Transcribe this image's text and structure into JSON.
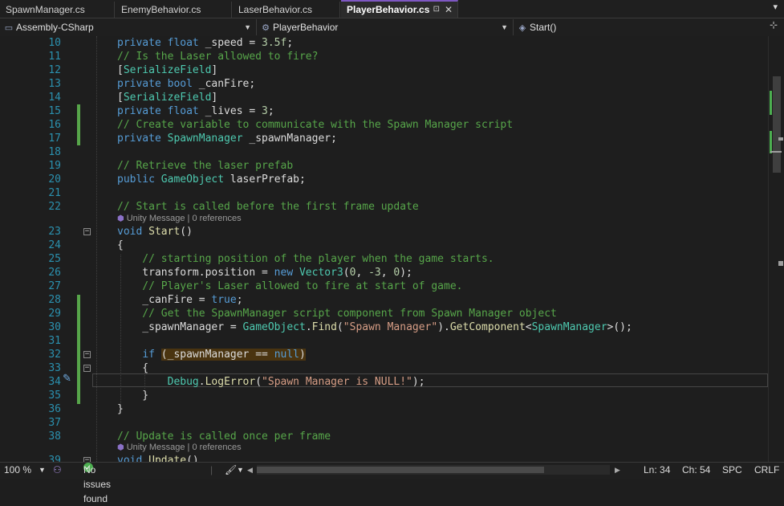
{
  "tabs": [
    {
      "label": "SpawnManager.cs",
      "active": false
    },
    {
      "label": "EnemyBehavior.cs",
      "active": false
    },
    {
      "label": "LaserBehavior.cs",
      "active": false
    },
    {
      "label": "PlayerBehavior.cs",
      "active": true
    }
  ],
  "nav": {
    "project": "Assembly-CSharp",
    "class": "PlayerBehavior",
    "member": "Start()"
  },
  "codelens": {
    "start": "Unity Message | 0 references",
    "update": "Unity Message | 0 references"
  },
  "lines": [
    {
      "n": "10",
      "text": "private float _speed = 3.5f;"
    },
    {
      "n": "11",
      "text": "// Is the Laser allowed to fire?"
    },
    {
      "n": "12",
      "text": "[SerializeField]"
    },
    {
      "n": "13",
      "text": "private bool _canFire;"
    },
    {
      "n": "14",
      "text": "[SerializeField]"
    },
    {
      "n": "15",
      "text": "private float _lives = 3;"
    },
    {
      "n": "16",
      "text": "// Create variable to communicate with the Spawn Manager script"
    },
    {
      "n": "17",
      "text": "private SpawnManager _spawnManager;"
    },
    {
      "n": "18",
      "text": ""
    },
    {
      "n": "19",
      "text": "// Retrieve the laser prefab"
    },
    {
      "n": "20",
      "text": "public GameObject laserPrefab;"
    },
    {
      "n": "21",
      "text": ""
    },
    {
      "n": "22",
      "text": "// Start is called before the first frame update"
    },
    {
      "n": "23",
      "text": "void Start()"
    },
    {
      "n": "24",
      "text": "{"
    },
    {
      "n": "25",
      "text": "    // starting position of the player when the game starts."
    },
    {
      "n": "26",
      "text": "    transform.position = new Vector3(0, -3, 0);"
    },
    {
      "n": "27",
      "text": "    // Player's Laser allowed to fire at start of game."
    },
    {
      "n": "28",
      "text": "    _canFire = true;"
    },
    {
      "n": "29",
      "text": "    // Get the SpawnManager script component from Spawn Manager object"
    },
    {
      "n": "30",
      "text": "    _spawnManager = GameObject.Find(\"Spawn Manager\").GetComponent<SpawnManager>();"
    },
    {
      "n": "31",
      "text": ""
    },
    {
      "n": "32",
      "text": "    if (_spawnManager == null)"
    },
    {
      "n": "33",
      "text": "    {"
    },
    {
      "n": "34",
      "text": "        Debug.LogError(\"Spawn Manager is NULL!\");"
    },
    {
      "n": "35",
      "text": "    }"
    },
    {
      "n": "36",
      "text": "}"
    },
    {
      "n": "37",
      "text": ""
    },
    {
      "n": "38",
      "text": "// Update is called once per frame"
    },
    {
      "n": "39",
      "text": "void Update()"
    }
  ],
  "status": {
    "zoom": "100 %",
    "issues": "No issues found",
    "line": "Ln: 34",
    "col": "Ch: 54",
    "spacing": "SPC",
    "eol": "CRLF"
  },
  "colors": {
    "keyword": "#569cd6",
    "type": "#4ec9b0",
    "comment": "#57a64a",
    "string": "#d69d85",
    "number": "#b5cea8",
    "method": "#dcdcaa",
    "line_number": "#2b91af",
    "tab_accent": "#7e57c2"
  }
}
